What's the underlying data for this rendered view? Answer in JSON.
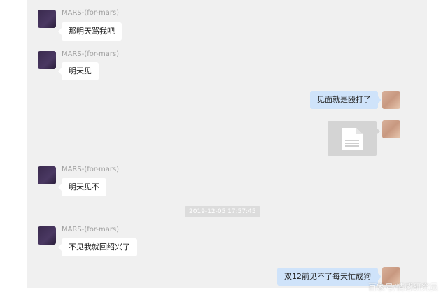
{
  "messages": [
    {
      "sender": "MARS-(for-mars)",
      "text": "那明天骂我吧"
    },
    {
      "sender": "MARS-(for-mars)",
      "text": "明天见"
    },
    {
      "text": "见面就是殴打了"
    },
    {
      "type": "file",
      "icon": "document-icon"
    },
    {
      "sender": "MARS-(for-mars)",
      "text": "明天见不"
    },
    {
      "timestamp": "2019-12-05 17:57:45"
    },
    {
      "sender": "MARS-(for-mars)",
      "text": "不见我就回绍兴了"
    },
    {
      "text": "双12前见不了每天忙成狗"
    }
  ],
  "watermark": "百家号/情感研究员"
}
